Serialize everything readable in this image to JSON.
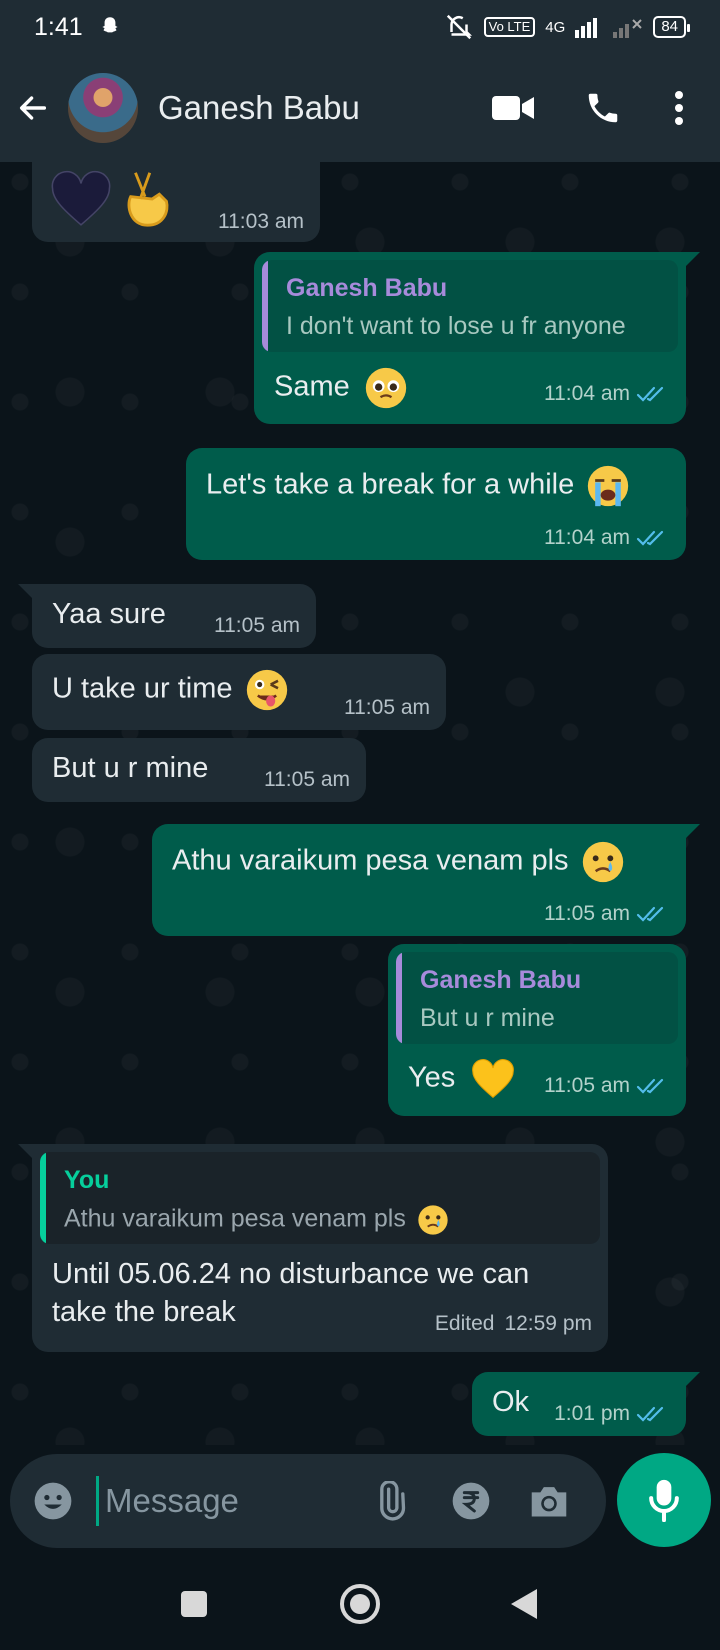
{
  "status_bar": {
    "time": "1:41",
    "volte": "Vo LTE",
    "network": "4G",
    "battery": "84"
  },
  "header": {
    "contact_name": "Ganesh Babu"
  },
  "messages": [
    {
      "dir": "in",
      "text": "",
      "emoji": [
        "black-heart",
        "crossed-fingers"
      ],
      "time": "11:03 am"
    },
    {
      "dir": "out",
      "reply_to": {
        "name": "Ganesh Babu",
        "text": "I don't want to lose u fr anyone"
      },
      "text": "Same",
      "emoji": [
        "pleading-face"
      ],
      "time": "11:04 am",
      "status": "read"
    },
    {
      "dir": "out",
      "text": "Let's take a break for a while",
      "emoji": [
        "loudly-crying-face"
      ],
      "time": "11:04 am",
      "status": "read"
    },
    {
      "dir": "in",
      "text": "Yaa sure",
      "time": "11:05 am"
    },
    {
      "dir": "in",
      "text": "U take ur time",
      "emoji": [
        "winking-face-with-tongue"
      ],
      "time": "11:05 am"
    },
    {
      "dir": "in",
      "text": "But u r mine",
      "time": "11:05 am"
    },
    {
      "dir": "out",
      "text": "Athu varaikum pesa venam pls",
      "emoji": [
        "crying-face"
      ],
      "time": "11:05 am",
      "status": "read"
    },
    {
      "dir": "out",
      "reply_to": {
        "name": "Ganesh Babu",
        "text": "But u r mine"
      },
      "text": "Yes",
      "emoji": [
        "yellow-heart"
      ],
      "time": "11:05 am",
      "status": "read"
    },
    {
      "dir": "in",
      "reply_to": {
        "name": "You",
        "text": "Athu varaikum pesa venam pls",
        "emoji": [
          "crying-face"
        ]
      },
      "text_lines": [
        "Until 05.06.24 no disturbance we can",
        "take the break"
      ],
      "edited_label": "Edited",
      "time": "12:59 pm"
    },
    {
      "dir": "out",
      "text": "Ok",
      "time": "1:01 pm",
      "status": "read"
    }
  ],
  "composer": {
    "placeholder": "Message"
  },
  "colors": {
    "incoming_bubble": "#1f2c34",
    "outgoing_bubble": "#005c4b",
    "accent": "#00a884",
    "reply_name_contact": "#a78bdb",
    "reply_name_you": "#06cf9c",
    "read_tick": "#53bdeb"
  }
}
